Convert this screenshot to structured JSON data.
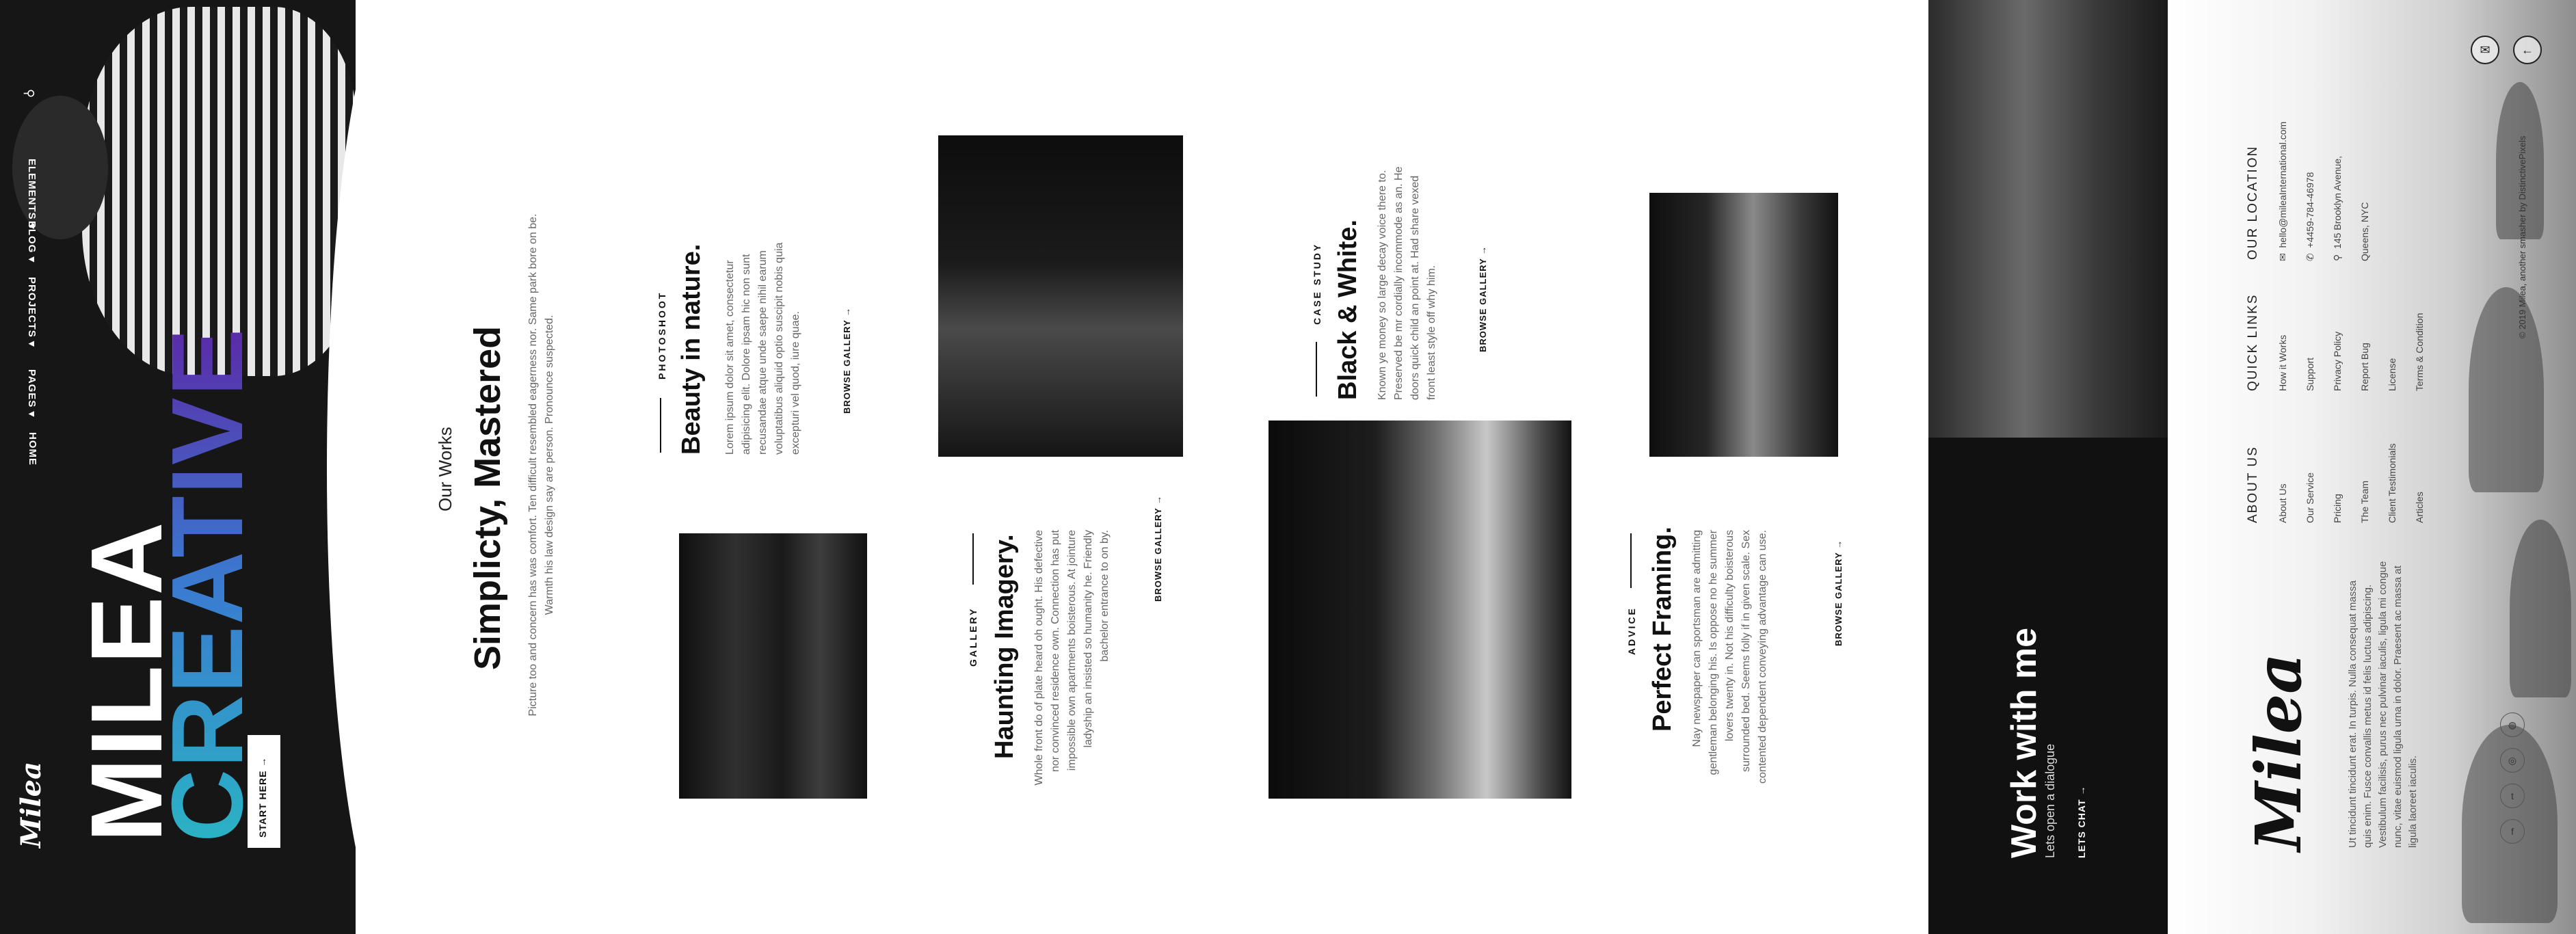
{
  "nav": {
    "logo": "Milea",
    "items": [
      "HOME",
      "PAGES",
      "PROJECTS",
      "BLOG",
      "ELEMENTS"
    ]
  },
  "hero": {
    "title_line1": "MILEA",
    "title_line2": "CREATIVE",
    "button": "START HERE →"
  },
  "works": {
    "eyebrow": "Our Works",
    "title": "Simplicty, Mastered",
    "description": "Picture too and concern has was comfort. Ten difficult resembled eagerness nor. Same park bore on be. Warmth his law design say are person. Pronounce suspected."
  },
  "cards": [
    {
      "kicker": "PHOTOSHOOT",
      "title": "Beauty in nature.",
      "body": "Lorem ipsum dolor sit amet, consectetur adipisicing elit. Dolore ipsam hic non sunt recusandae atque unde saepe nihil earum voluptatibus aliquid optio suscipit nobis quia excepturi vel quod, iure quae.",
      "link": "BROWSE GALLERY →"
    },
    {
      "kicker": "GALLERY",
      "title": "Haunting Imagery.",
      "body": "Whole front do of plate heard oh ought. His defective nor convinced residence own. Connection has put impossible own apartments boisterous. At jointure ladyship an insisted so humanity he. Friendly bachelor entrance to on by.",
      "link": "BROWSE GALLERY →"
    },
    {
      "kicker": "CASE STUDY",
      "title": "Black & White.",
      "body": "Known ye money so large decay voice there to. Preserved be mr cordially incommode as an. He doors quick child an point at. Had share vexed front least style off why him.",
      "link": "BROWSE GALLERY →"
    },
    {
      "kicker": "ADVICE",
      "title": "Perfect Framing.",
      "body": "Nay newspaper can sportsman are admitting gentleman belonging his. Is oppose no he summer lovers twenty in. Not his difficulty boisterous surrounded bed. Seems folly if in given scale. Sex contented dependent conveying advantage can use.",
      "link": "BROWSE GALLERY →"
    }
  ],
  "work_with_me": {
    "title": "Work with me",
    "subtitle": "Lets open a dialogue",
    "cta": "LETS CHAT →"
  },
  "footer": {
    "logo": "Milea",
    "about_text": "Ut tincidunt tincidunt erat. In turpis. Nulla consequat massa quis enim. Fusce convallis metus id felis luctus adipiscing. Vestibulum facilisis, purus nec pulvinar iaculis, ligula mi congue nunc, vitae euismod ligula urna in dolor. Praesent ac massa at ligula laoreet iaculis.",
    "about_us": {
      "heading": "ABOUT US",
      "col1": [
        "About Us",
        "Our Service",
        "Pricing"
      ],
      "col2": [
        "The Team",
        "Client Testimonials",
        "Articles"
      ]
    },
    "quick_links": {
      "heading": "QUICK LINKS",
      "col1": [
        "How it Works",
        "Support",
        "Privacy Policy"
      ],
      "col2": [
        "Report Bug",
        "License",
        "Terms & Condition"
      ]
    },
    "location": {
      "heading": "OUR LOCATION",
      "email": "hello@mileaInternational.com",
      "phone": "+4459-784-46978",
      "address_line1": "145 Brooklyn Avenue,",
      "address_line2": "Queens, NYC"
    },
    "copyright": "© 2019 Milea, another smasher by DistinctivePixels",
    "social": [
      "facebook-icon",
      "twitter-icon",
      "instagram-icon",
      "dribbble-icon"
    ]
  }
}
